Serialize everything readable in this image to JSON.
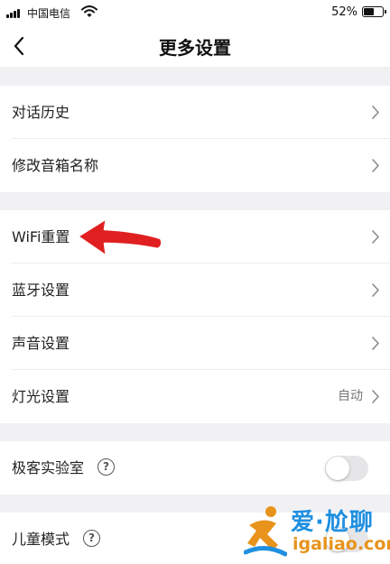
{
  "status_bar": {
    "carrier": "中国电信",
    "battery": "52%",
    "battery_level": 0.52
  },
  "nav": {
    "title": "更多设置"
  },
  "group1": {
    "items": [
      {
        "label": "对话历史"
      },
      {
        "label": "修改音箱名称"
      }
    ]
  },
  "group2": {
    "items": [
      {
        "label": "WiFi重置"
      },
      {
        "label": "蓝牙设置"
      },
      {
        "label": "声音设置"
      },
      {
        "label": "灯光设置",
        "value": "自动"
      }
    ]
  },
  "group3": {
    "items": [
      {
        "label": "极客实验室",
        "help": "?",
        "toggle_on": false
      }
    ]
  },
  "group4": {
    "items": [
      {
        "label": "儿童模式",
        "help": "?",
        "toggle_on": false
      }
    ]
  },
  "colors": {
    "annotation_arrow": "#e02020",
    "watermark_blue": "#1f8fe0",
    "watermark_orange": "#e8931c"
  },
  "watermark": {
    "name": "爱·尬聊",
    "domain": "igaliao.com"
  }
}
